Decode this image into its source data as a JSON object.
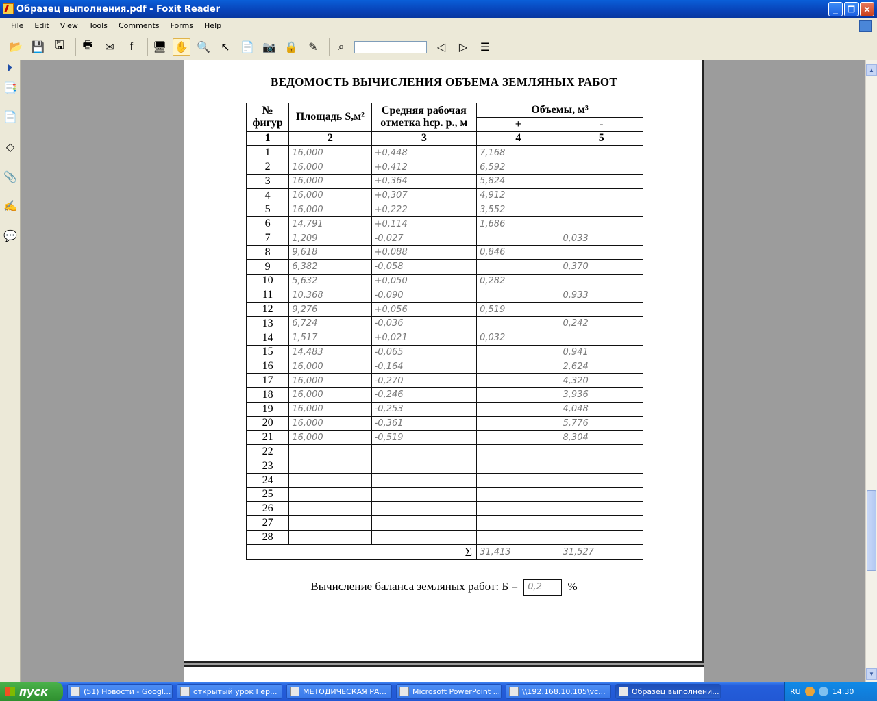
{
  "window": {
    "title": "Образец выполнения.pdf - Foxit Reader"
  },
  "menu": [
    "File",
    "Edit",
    "View",
    "Tools",
    "Comments",
    "Forms",
    "Help"
  ],
  "toolbar": {
    "search_value": ""
  },
  "document": {
    "title": "ВЕДОМОСТЬ ВЫЧИСЛЕНИЯ ОБЪЕМА ЗЕМЛЯНЫХ РАБОТ",
    "headers": {
      "col1": "№ фигур",
      "col2": "Площадь S,м²",
      "col3": "Средняя рабочая отметка hср. р., м",
      "volumes": "Объемы, м³",
      "plus": "+",
      "minus": "-",
      "n1": "1",
      "n2": "2",
      "n3": "3",
      "n4": "4",
      "n5": "5"
    },
    "rows": [
      [
        "1",
        "16,000",
        "+0,448",
        "7,168",
        ""
      ],
      [
        "2",
        "16,000",
        "+0,412",
        "6,592",
        ""
      ],
      [
        "3",
        "16,000",
        "+0,364",
        "5,824",
        ""
      ],
      [
        "4",
        "16,000",
        "+0,307",
        "4,912",
        ""
      ],
      [
        "5",
        "16,000",
        "+0,222",
        "3,552",
        ""
      ],
      [
        "6",
        "14,791",
        "+0,114",
        "1,686",
        ""
      ],
      [
        "7",
        "1,209",
        "-0,027",
        "",
        "0,033"
      ],
      [
        "8",
        "9,618",
        "+0,088",
        "0,846",
        ""
      ],
      [
        "9",
        "6,382",
        "-0,058",
        "",
        "0,370"
      ],
      [
        "10",
        "5,632",
        "+0,050",
        "0,282",
        ""
      ],
      [
        "11",
        "10,368",
        "-0,090",
        "",
        "0,933"
      ],
      [
        "12",
        "9,276",
        "+0,056",
        "0,519",
        ""
      ],
      [
        "13",
        "6,724",
        "-0,036",
        "",
        "0,242"
      ],
      [
        "14",
        "1,517",
        "+0,021",
        "0,032",
        ""
      ],
      [
        "15",
        "14,483",
        "-0,065",
        "",
        "0,941"
      ],
      [
        "16",
        "16,000",
        "-0,164",
        "",
        "2,624"
      ],
      [
        "17",
        "16,000",
        "-0,270",
        "",
        "4,320"
      ],
      [
        "18",
        "16,000",
        "-0,246",
        "",
        "3,936"
      ],
      [
        "19",
        "16,000",
        "-0,253",
        "",
        "4,048"
      ],
      [
        "20",
        "16,000",
        "-0,361",
        "",
        "5,776"
      ],
      [
        "21",
        "16,000",
        "-0,519",
        "",
        "8,304"
      ],
      [
        "22",
        "",
        "",
        "",
        ""
      ],
      [
        "23",
        "",
        "",
        "",
        ""
      ],
      [
        "24",
        "",
        "",
        "",
        ""
      ],
      [
        "25",
        "",
        "",
        "",
        ""
      ],
      [
        "26",
        "",
        "",
        "",
        ""
      ],
      [
        "27",
        "",
        "",
        "",
        ""
      ],
      [
        "28",
        "",
        "",
        "",
        ""
      ]
    ],
    "sum": {
      "symbol": "Σ",
      "plus": "31,413",
      "minus": "31,527"
    },
    "balance": {
      "label": "Вычисление баланса земляных работ: Б =",
      "value": "0,2",
      "unit": "%"
    }
  },
  "taskbar": {
    "start": "пуск",
    "tasks": [
      "(51) Новости - Googl...",
      "открытый урок Гер...",
      "МЕТОДИЧЕСКАЯ РА...",
      "Microsoft PowerPoint ...",
      "\\\\192.168.10.105\\vc...",
      "Образец выполнени..."
    ],
    "lang": "RU",
    "clock": "14:30"
  }
}
